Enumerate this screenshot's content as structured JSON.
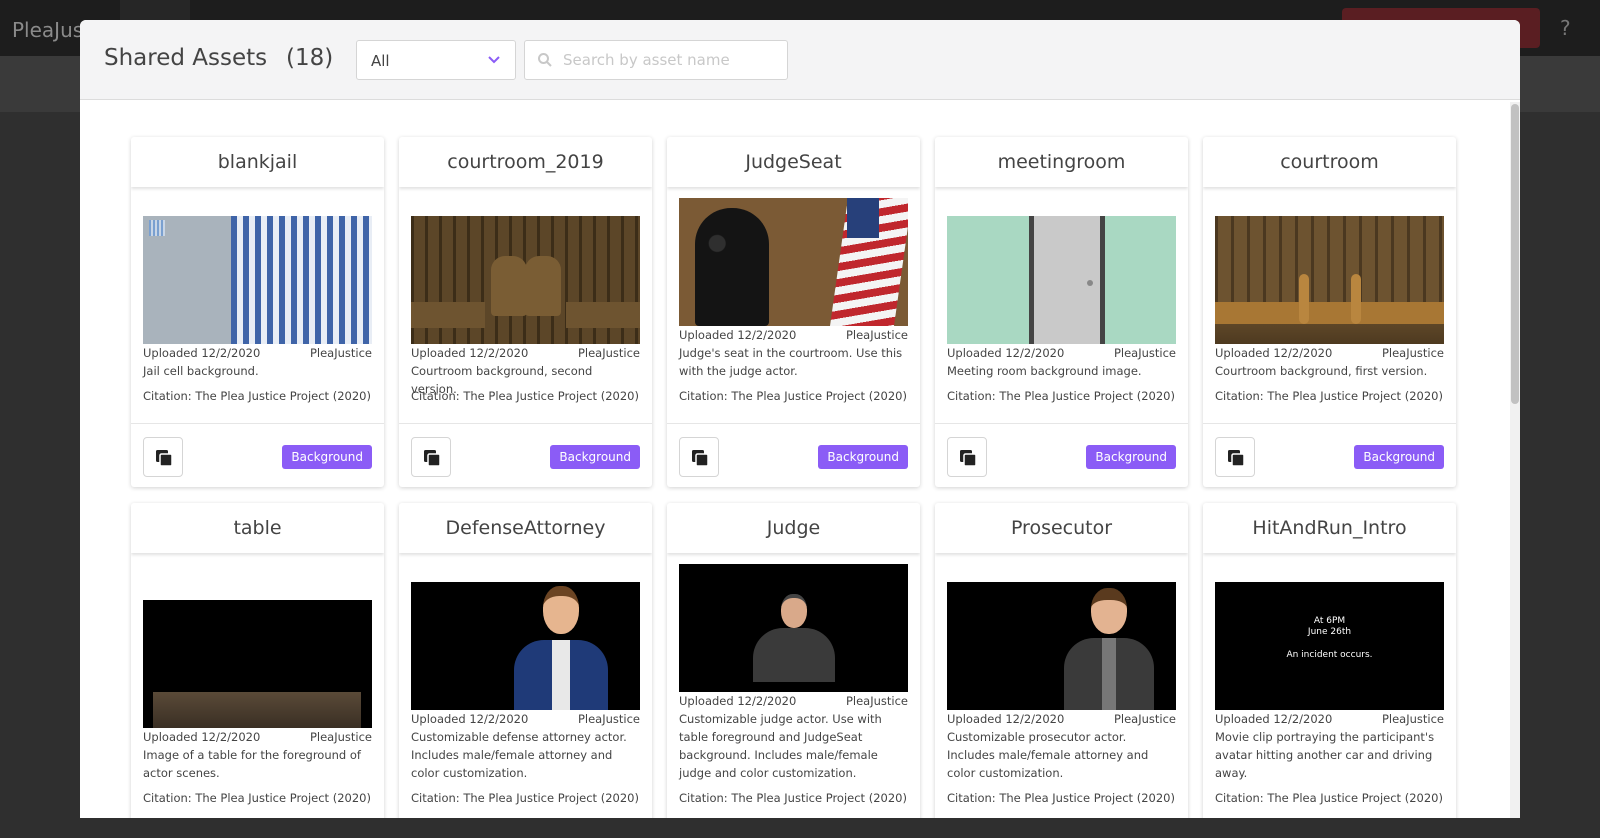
{
  "background_app": {
    "brand": "PleaJustice",
    "help_label": "?"
  },
  "modal": {
    "title": "Shared Assets",
    "count": "(18)",
    "filter": {
      "selected": "All"
    },
    "search": {
      "placeholder": "Search by asset name",
      "value": ""
    }
  },
  "colors": {
    "tag_background": "#8b5cf6",
    "header_background": "#f4f4f5"
  },
  "cards": [
    {
      "name": "blankjail",
      "uploaded": "Uploaded 12/2/2020",
      "owner": "PleaJustice",
      "description": "Jail cell background.",
      "citation": "Citation: The Plea Justice Project (2020)",
      "tag": "Background",
      "thumbnail": "jail-cell-image"
    },
    {
      "name": "courtroom_2019",
      "uploaded": "Uploaded 12/2/2020",
      "owner": "PleaJustice",
      "description": "Courtroom background, second version.",
      "citation": "Citation: The Plea Justice Project (2020)",
      "tag": "Background",
      "thumbnail": "courtroom-v2-image"
    },
    {
      "name": "JudgeSeat",
      "uploaded": "Uploaded 12/2/2020",
      "owner": "PleaJustice",
      "description": "Judge's seat in the courtroom. Use this with the judge actor.",
      "citation": "Citation: The Plea Justice Project (2020)",
      "tag": "Background",
      "thumbnail": "judge-seat-flag-image"
    },
    {
      "name": "meetingroom",
      "uploaded": "Uploaded 12/2/2020",
      "owner": "PleaJustice",
      "description": "Meeting room background image.",
      "citation": "Citation: The Plea Justice Project (2020)",
      "tag": "Background",
      "thumbnail": "meeting-room-door-image"
    },
    {
      "name": "courtroom",
      "uploaded": "Uploaded 12/2/2020",
      "owner": "PleaJustice",
      "description": "Courtroom background, first version.",
      "citation": "Citation: The Plea Justice Project (2020)",
      "tag": "Background",
      "thumbnail": "courtroom-v1-image"
    },
    {
      "name": "table",
      "uploaded": "Uploaded 12/2/2020",
      "owner": "PleaJustice",
      "description": "Image of a table for the foreground of actor scenes.",
      "citation": "Citation: The Plea Justice Project (2020)",
      "thumbnail": "table-image"
    },
    {
      "name": "DefenseAttorney",
      "uploaded": "Uploaded 12/2/2020",
      "owner": "PleaJustice",
      "description": "Customizable defense attorney actor. Includes male/female attorney and color customization.",
      "citation": "Citation: The Plea Justice Project (2020)",
      "thumbnail": "defense-attorney-image"
    },
    {
      "name": "Judge",
      "uploaded": "Uploaded 12/2/2020",
      "owner": "PleaJustice",
      "description": "Customizable judge actor. Use with table foreground and JudgeSeat background. Includes male/female judge and color customization.",
      "citation": "Citation: The Plea Justice Project (2020)",
      "thumbnail": "judge-image"
    },
    {
      "name": "Prosecutor",
      "uploaded": "Uploaded 12/2/2020",
      "owner": "PleaJustice",
      "description": "Customizable prosecutor actor. Includes male/female attorney and color customization.",
      "citation": "Citation: The Plea Justice Project (2020)",
      "thumbnail": "prosecutor-image"
    },
    {
      "name": "HitAndRun_Intro",
      "uploaded": "Uploaded 12/2/2020",
      "owner": "PleaJustice",
      "description": "Movie clip portraying the participant's avatar hitting another car and driving away.",
      "citation": "Citation: The Plea Justice Project (2020)",
      "thumbnail": "hit-and-run-intro-video",
      "thumbnail_text": {
        "line1": "At 6PM",
        "line2": "June 26th",
        "line3": "An incident occurs."
      }
    }
  ]
}
